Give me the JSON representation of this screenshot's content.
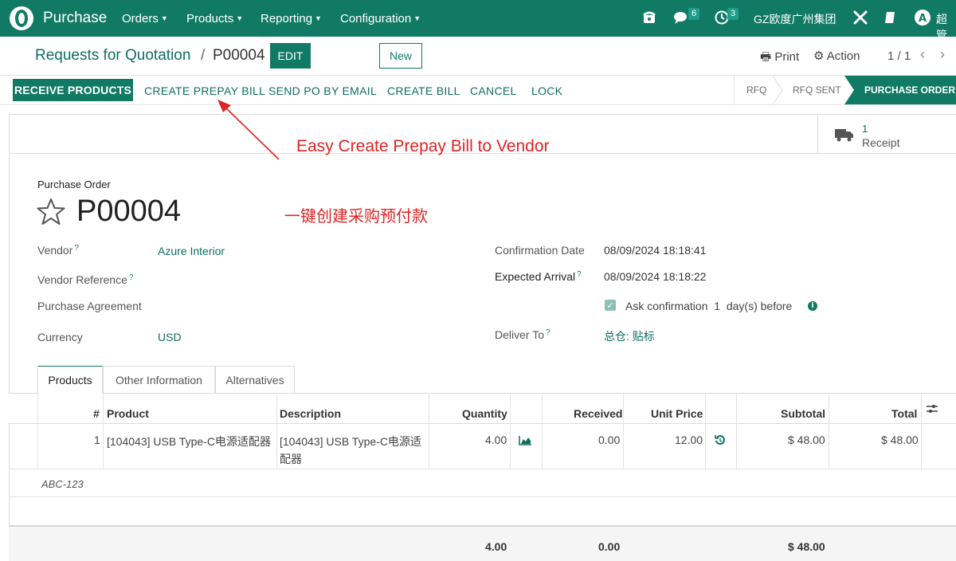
{
  "nav": {
    "app_name": "Purchase",
    "menus": [
      "Orders",
      "Products",
      "Reporting",
      "Configuration"
    ],
    "messages_count": "6",
    "activities_count": "3",
    "company": "GZ欧度广州集团",
    "user": "超管"
  },
  "control": {
    "breadcrumb_parent": "Requests for Quotation",
    "breadcrumb_sep": "/",
    "breadcrumb_current": "P00004",
    "edit_label": "EDIT",
    "new_label": "New",
    "print_label": "Print",
    "action_label": "Action",
    "pager": "1 / 1"
  },
  "statusbar": {
    "buttons": [
      "RECEIVE PRODUCTS",
      "CREATE PREPAY BILL",
      "SEND PO BY EMAIL",
      "CREATE BILL",
      "CANCEL",
      "LOCK"
    ],
    "stages": [
      "RFQ",
      "RFQ SENT",
      "PURCHASE ORDER"
    ],
    "active_stage": "PURCHASE ORDER"
  },
  "smart_button": {
    "value": "1",
    "label": "Receipt"
  },
  "annotations": {
    "english": "Easy Create Prepay Bill to Vendor",
    "chinese": "一键创建采购预付款",
    "arrow_color": "#e02424"
  },
  "form": {
    "title_label": "Purchase Order",
    "name": "P00004",
    "vendor_label": "Vendor",
    "vendor_value": "Azure Interior",
    "vendor_ref_label": "Vendor Reference",
    "agreement_label": "Purchase Agreement",
    "currency_label": "Currency",
    "currency_value": "USD",
    "confirmation_label": "Confirmation Date",
    "confirmation_value": "08/09/2024 18:18:41",
    "expected_label": "Expected Arrival",
    "expected_value": "08/09/2024 18:18:22",
    "ask_text": "Ask confirmation",
    "ask_days": "1",
    "ask_suffix": "day(s) before",
    "ask_checked": true,
    "deliver_label": "Deliver To",
    "deliver_value": "总仓: 贴标"
  },
  "tabs": [
    "Products",
    "Other Information",
    "Alternatives"
  ],
  "table": {
    "headers": [
      "#",
      "Product",
      "Description",
      "Quantity",
      "Received",
      "Unit Price",
      "Subtotal",
      "Total"
    ],
    "rows": [
      {
        "num": "1",
        "product": "[104043] USB Type-C电源适配器",
        "description_1": "[104043] USB Type-C电源适",
        "description_2": "配器",
        "quantity": "4.00",
        "received": "0.00",
        "unit_price": "12.00",
        "subtotal": "$ 48.00",
        "total": "$ 48.00"
      }
    ],
    "note": "ABC-123",
    "footer": {
      "quantity": "4.00",
      "received": "0.00",
      "subtotal": "$ 48.00"
    }
  },
  "colors": {
    "brand": "#117a65",
    "link": "#0f6d62",
    "annotation": "#e02424"
  }
}
